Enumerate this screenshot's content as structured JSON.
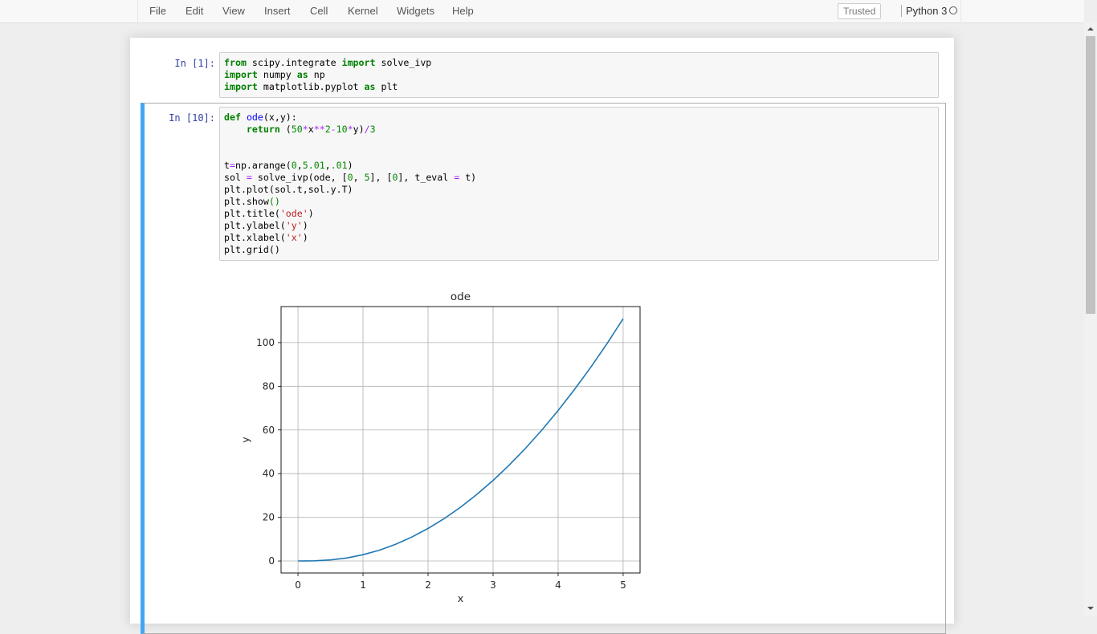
{
  "menubar": {
    "items": [
      "File",
      "Edit",
      "View",
      "Insert",
      "Cell",
      "Kernel",
      "Widgets",
      "Help"
    ],
    "trusted": "Trusted",
    "kernel": "Python 3"
  },
  "cells": [
    {
      "prompt": "In [1]:",
      "lines": [
        [
          [
            "from",
            "kw"
          ],
          [
            " scipy.integrate ",
            ""
          ],
          [
            "import",
            "kw"
          ],
          [
            " solve_ivp",
            ""
          ]
        ],
        [
          [
            "import",
            "kw"
          ],
          [
            " numpy ",
            ""
          ],
          [
            "as",
            "kw"
          ],
          [
            " np",
            ""
          ]
        ],
        [
          [
            "import",
            "kw"
          ],
          [
            " matplotlib.pyplot ",
            ""
          ],
          [
            "as",
            "kw"
          ],
          [
            " plt",
            ""
          ]
        ]
      ]
    },
    {
      "prompt": "In [10]:",
      "lines": [
        [
          [
            "def",
            "kw"
          ],
          [
            " ",
            ""
          ],
          [
            "ode",
            "fn"
          ],
          [
            "(x,y):",
            ""
          ]
        ],
        [
          [
            "    ",
            ""
          ],
          [
            "return",
            "kw"
          ],
          [
            " (",
            ""
          ],
          [
            "50",
            "num"
          ],
          [
            "*",
            "op"
          ],
          [
            "x",
            ""
          ],
          [
            "**",
            "op"
          ],
          [
            "2",
            "num"
          ],
          [
            "-",
            "op"
          ],
          [
            "10",
            "num"
          ],
          [
            "*",
            "op"
          ],
          [
            "y)",
            ""
          ],
          [
            "/",
            "op"
          ],
          [
            "3",
            "num"
          ]
        ],
        [],
        [],
        [
          [
            "t",
            ""
          ],
          [
            "=",
            "op"
          ],
          [
            "np.arange(",
            ""
          ],
          [
            "0",
            "num"
          ],
          [
            ",",
            ""
          ],
          [
            "5.01",
            "num"
          ],
          [
            ",",
            ""
          ],
          [
            ".01",
            "num"
          ],
          [
            ")",
            ""
          ]
        ],
        [
          [
            "sol ",
            ""
          ],
          [
            "=",
            "op"
          ],
          [
            " solve_ivp(ode, [",
            ""
          ],
          [
            "0",
            "num"
          ],
          [
            ", ",
            ""
          ],
          [
            "5",
            "num"
          ],
          [
            "], [",
            ""
          ],
          [
            "0",
            "num"
          ],
          [
            "], t_eval ",
            ""
          ],
          [
            "=",
            "op"
          ],
          [
            " t)",
            ""
          ]
        ],
        [
          [
            "plt.plot(sol.t,sol.y.T)",
            ""
          ]
        ],
        [
          [
            "plt.show",
            ""
          ],
          [
            "()",
            "par"
          ]
        ],
        [
          [
            "plt.title(",
            ""
          ],
          [
            "'ode'",
            "str"
          ],
          [
            ")",
            ""
          ]
        ],
        [
          [
            "plt.ylabel(",
            ""
          ],
          [
            "'y'",
            "str"
          ],
          [
            ")",
            ""
          ]
        ],
        [
          [
            "plt.xlabel(",
            ""
          ],
          [
            "'x'",
            "str"
          ],
          [
            ")",
            ""
          ]
        ],
        [
          [
            "plt.grid()",
            ""
          ]
        ]
      ]
    }
  ],
  "chart_data": {
    "type": "line",
    "title": "ode",
    "xlabel": "x",
    "ylabel": "y",
    "xlim": [
      -0.26,
      5.26
    ],
    "ylim": [
      -5.5,
      116.5
    ],
    "xticks": [
      0,
      1,
      2,
      3,
      4,
      5
    ],
    "yticks": [
      0,
      20,
      40,
      60,
      80,
      100
    ],
    "grid": true,
    "line_color": "#1f77b4",
    "series": [
      {
        "name": "sol.y",
        "x": [
          0,
          0.25,
          0.5,
          0.75,
          1,
          1.25,
          1.5,
          1.75,
          2,
          2.25,
          2.5,
          2.75,
          3,
          3.25,
          3.5,
          3.75,
          4,
          4.25,
          4.5,
          4.75,
          5
        ],
        "y": [
          0,
          0.07,
          0.48,
          1.39,
          2.87,
          4.95,
          7.64,
          10.96,
          14.9,
          19.46,
          24.65,
          30.46,
          36.9,
          43.96,
          51.65,
          59.96,
          68.9,
          78.46,
          88.65,
          99.46,
          110.9
        ]
      }
    ]
  }
}
